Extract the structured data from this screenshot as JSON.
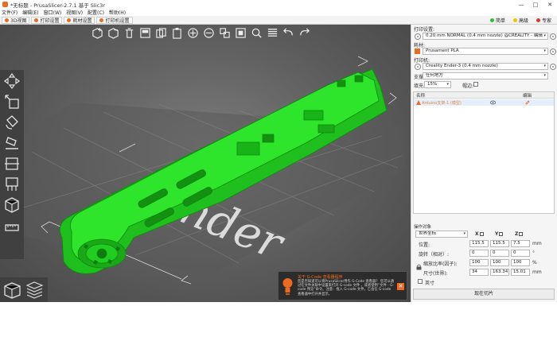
{
  "window": {
    "title": "*无标题 - PrusaSlicer-2.7.1 基于 Slic3r",
    "controls": [
      "—",
      "□",
      "✕"
    ]
  },
  "menu": [
    "文件(F)",
    "编辑(E)",
    "窗口(W)",
    "视图(V)",
    "配置(C)",
    "帮助(H)"
  ],
  "tabs": [
    {
      "label": "3D视图",
      "active": true
    },
    {
      "label": "打印设置",
      "active": false
    },
    {
      "label": "耗材设置",
      "active": false
    },
    {
      "label": "打印机设置",
      "active": false
    }
  ],
  "mode": [
    {
      "label": "简单",
      "color": "#2ebd3c"
    },
    {
      "label": "高级",
      "color": "#f5c400"
    },
    {
      "label": "专家",
      "color": "#e3342f"
    }
  ],
  "canvas": {
    "accent": "#ed6b21",
    "model_color": "#21d21f",
    "bed_logo_text": "Ender"
  },
  "notification": {
    "title": "关于 G-Code 查看器程序",
    "body": "您是否知道可以将PrusaSlicer用作 G-Code 查看器？ 您可以通过在文件关联中设置来打开 G-code 文件 ，或者使用“文件 - G-code 预览”命令。注意：拖入 G-code 文件，它会在 G-code 查看器中打开并显示。"
  },
  "sidebar": {
    "print_settings_label": "打印设置:",
    "print_settings_value": "0.20 mm NORMAL (0.4 mm nozzle) @CREALITY - 编辑",
    "filament_label": "耗材:",
    "filament_value": "Prusament PLA",
    "filament_color": "#ed6b21",
    "printer_label": "打印机:",
    "printer_value": "Creality Ender-3 (0.4 mm nozzle)",
    "support_label": "支撑:",
    "support_value": "任何地方",
    "infill_label": "填充:",
    "infill_value": "15%",
    "brim_label": "帽边:",
    "list_col_name": "名称",
    "list_col_edit": "编辑",
    "object_name": "Arduino支架-1 (模型)",
    "manipulation_title": "操作对象",
    "coord_system": "世界坐标",
    "axes": [
      "X",
      "Y",
      "Z"
    ],
    "position_label": "位置:",
    "position": [
      "115.5",
      "115.5",
      "7.5"
    ],
    "position_unit": "mm",
    "rotation_label": "旋转（相对）:",
    "rotation": [
      "0",
      "0",
      "0"
    ],
    "rotation_unit": "°",
    "scale_label": "缩放比率(因子):",
    "scale": [
      "100",
      "100",
      "100"
    ],
    "scale_unit": "%",
    "size_label": "尺寸(世界):",
    "size": [
      "34",
      "163.34",
      "15.01"
    ],
    "size_unit": "mm",
    "inches_label": "英寸",
    "slice_button": "现在切片"
  }
}
